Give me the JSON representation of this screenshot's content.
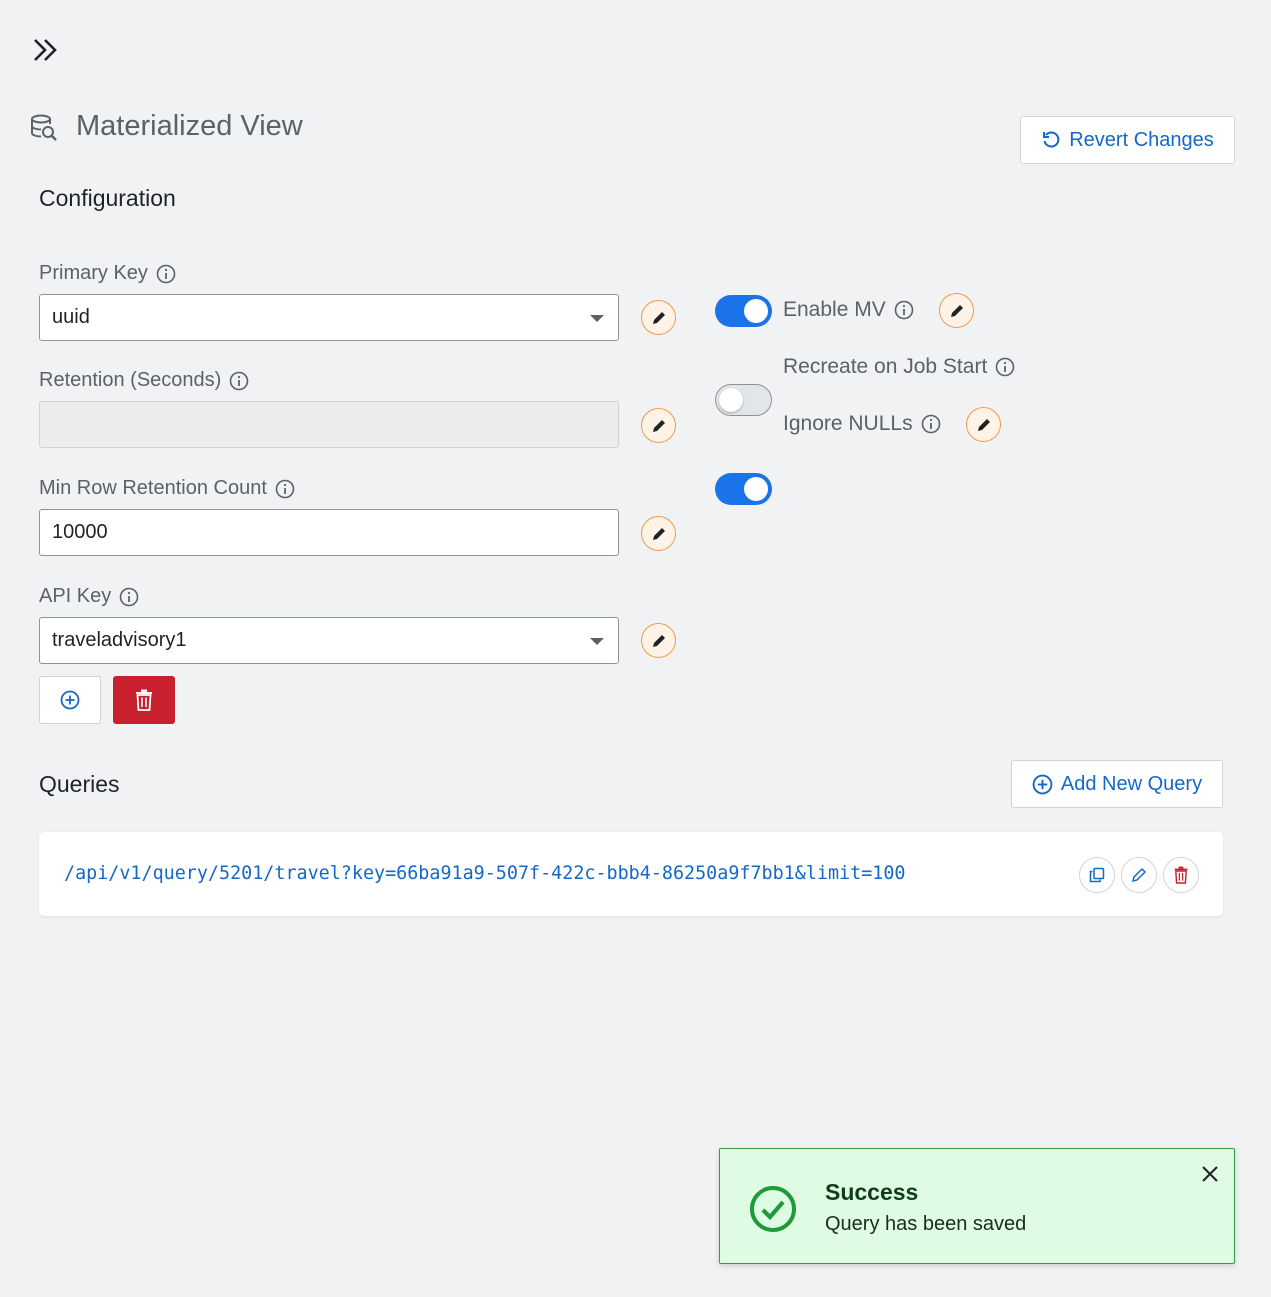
{
  "header": {
    "title": "Materialized View",
    "revert_label": "Revert Changes"
  },
  "configuration": {
    "title": "Configuration",
    "primary_key": {
      "label": "Primary Key",
      "value": "uuid"
    },
    "retention": {
      "label": "Retention (Seconds)",
      "value": ""
    },
    "min_row": {
      "label": "Min Row Retention Count",
      "value": "10000"
    },
    "api_key": {
      "label": "API Key",
      "value": "traveladvisory1"
    },
    "toggles": {
      "enable_mv": {
        "label": "Enable MV",
        "on": true
      },
      "recreate": {
        "label": "Recreate on Job Start",
        "on": false
      },
      "ignore_nulls": {
        "label": "Ignore NULLs",
        "on": true
      }
    }
  },
  "queries": {
    "title": "Queries",
    "add_label": "Add New Query",
    "items": [
      {
        "url": "/api/v1/query/5201/travel?key=66ba91a9-507f-422c-bbb4-86250a9f7bb1&limit=100"
      }
    ]
  },
  "toast": {
    "title": "Success",
    "message": "Query has been saved"
  },
  "colors": {
    "accent": "#1a73e8",
    "link": "#1468c8",
    "danger": "#c8202c",
    "edit_ring": "#f09a4a",
    "success_bg": "#e0fbe3",
    "success_icon": "#1e9a3a"
  }
}
